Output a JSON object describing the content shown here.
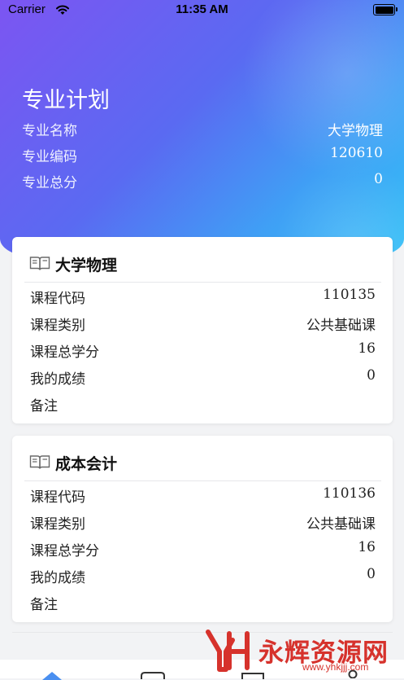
{
  "status_bar": {
    "carrier": "Carrier",
    "time": "11:35 AM"
  },
  "header": {
    "title": "专业计划",
    "rows": [
      {
        "label": "专业名称",
        "value": "大学物理"
      },
      {
        "label": "专业编码",
        "value": "120610"
      },
      {
        "label": "专业总分",
        "value": "0"
      }
    ]
  },
  "courses": [
    {
      "name": "大学物理",
      "rows": [
        {
          "label": "课程代码",
          "value": "110135"
        },
        {
          "label": "课程类别",
          "value": "公共基础课"
        },
        {
          "label": "课程总学分",
          "value": "16"
        },
        {
          "label": "我的成绩",
          "value": "0"
        },
        {
          "label": "备注",
          "value": ""
        }
      ]
    },
    {
      "name": "成本会计",
      "rows": [
        {
          "label": "课程代码",
          "value": "110136"
        },
        {
          "label": "课程类别",
          "value": "公共基础课"
        },
        {
          "label": "课程总学分",
          "value": "16"
        },
        {
          "label": "我的成绩",
          "value": "0"
        },
        {
          "label": "备注",
          "value": ""
        }
      ]
    }
  ],
  "watermark": {
    "text": "永辉资源网",
    "url": "www.yhkjjj.com"
  },
  "colors": {
    "accent_start": "#7c55f2",
    "accent_end": "#35c0f7",
    "watermark": "#d6322c"
  }
}
